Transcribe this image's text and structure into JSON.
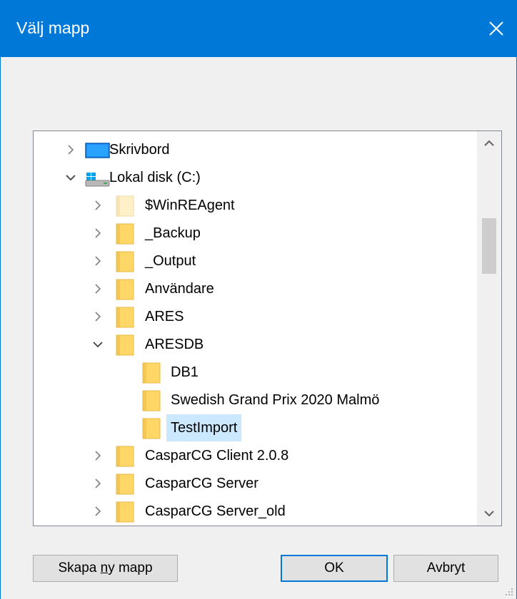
{
  "dialog": {
    "title": "Välj mapp",
    "close_icon": "close-icon"
  },
  "tree": {
    "items": [
      {
        "label": "Skrivbord",
        "level": 0,
        "chevron": "right",
        "icon": "desktop-icon"
      },
      {
        "label": "Lokal disk (C:)",
        "level": 0,
        "chevron": "down",
        "icon": "drive-icon"
      },
      {
        "label": "$WinREAgent",
        "level": 1,
        "chevron": "right",
        "icon": "folder-hidden-icon"
      },
      {
        "label": "_Backup",
        "level": 1,
        "chevron": "right",
        "icon": "folder-icon"
      },
      {
        "label": "_Output",
        "level": 1,
        "chevron": "right",
        "icon": "folder-icon"
      },
      {
        "label": "Användare",
        "level": 1,
        "chevron": "right",
        "icon": "folder-icon"
      },
      {
        "label": "ARES",
        "level": 1,
        "chevron": "right",
        "icon": "folder-icon"
      },
      {
        "label": "ARESDB",
        "level": 1,
        "chevron": "down",
        "icon": "folder-icon"
      },
      {
        "label": "DB1",
        "level": 2,
        "chevron": "none",
        "icon": "folder-icon"
      },
      {
        "label": "Swedish Grand Prix 2020 Malmö",
        "level": 2,
        "chevron": "none",
        "icon": "folder-icon"
      },
      {
        "label": "TestImport",
        "level": 2,
        "chevron": "none",
        "icon": "folder-icon",
        "selected": true
      },
      {
        "label": "CasparCG Client 2.0.8",
        "level": 1,
        "chevron": "right",
        "icon": "folder-icon"
      },
      {
        "label": "CasparCG Server",
        "level": 1,
        "chevron": "right",
        "icon": "folder-icon"
      },
      {
        "label": "CasparCG Server_old",
        "level": 1,
        "chevron": "right",
        "icon": "folder-icon"
      }
    ]
  },
  "buttons": {
    "new_folder_pre": "Skapa ",
    "new_folder_u": "n",
    "new_folder_post": "y mapp",
    "ok": "OK",
    "cancel": "Avbryt"
  },
  "colors": {
    "accent": "#0078d7",
    "selection": "#cce8ff",
    "folder": "#ffd766"
  }
}
